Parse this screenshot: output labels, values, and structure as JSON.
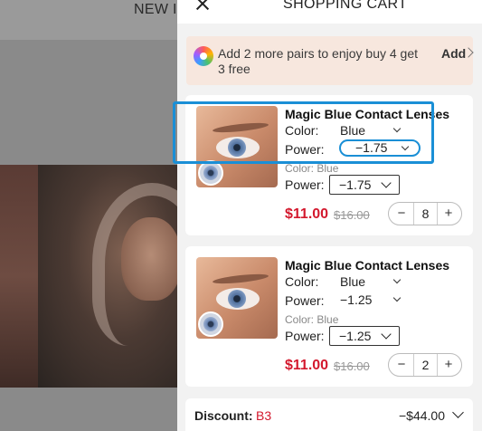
{
  "background": {
    "nav_text": "NEW I"
  },
  "drawer": {
    "title": "SHOPPING CART"
  },
  "promo": {
    "text": "Add 2 more pairs to enjoy buy 4 get 3 free",
    "action": "Add"
  },
  "items": [
    {
      "name": "Magic Blue Contact Lenses",
      "color_label": "Color:",
      "color_value": "Blue",
      "power_label": "Power:",
      "power_value": "−1.75",
      "detail_color": "Color: Blue",
      "detail_power_label": "Power:",
      "detail_power_value": "−1.75",
      "price": "$11.00",
      "original_price": "$16.00",
      "quantity": "8",
      "minus": "−",
      "plus": "+"
    },
    {
      "name": "Magic Blue Contact Lenses",
      "color_label": "Color:",
      "color_value": "Blue",
      "power_label": "Power:",
      "power_value": "−1.25",
      "detail_color": "Color: Blue",
      "detail_power_label": "Power:",
      "detail_power_value": "−1.25",
      "price": "$11.00",
      "original_price": "$16.00",
      "quantity": "2",
      "minus": "−",
      "plus": "+"
    }
  ],
  "discount": {
    "label": "Discount:",
    "code": "B3",
    "amount": "−$44.00"
  },
  "colors": {
    "price_red": "#d3182d",
    "highlight_blue": "#1a8fd6",
    "promo_bg": "#f7e7de"
  }
}
